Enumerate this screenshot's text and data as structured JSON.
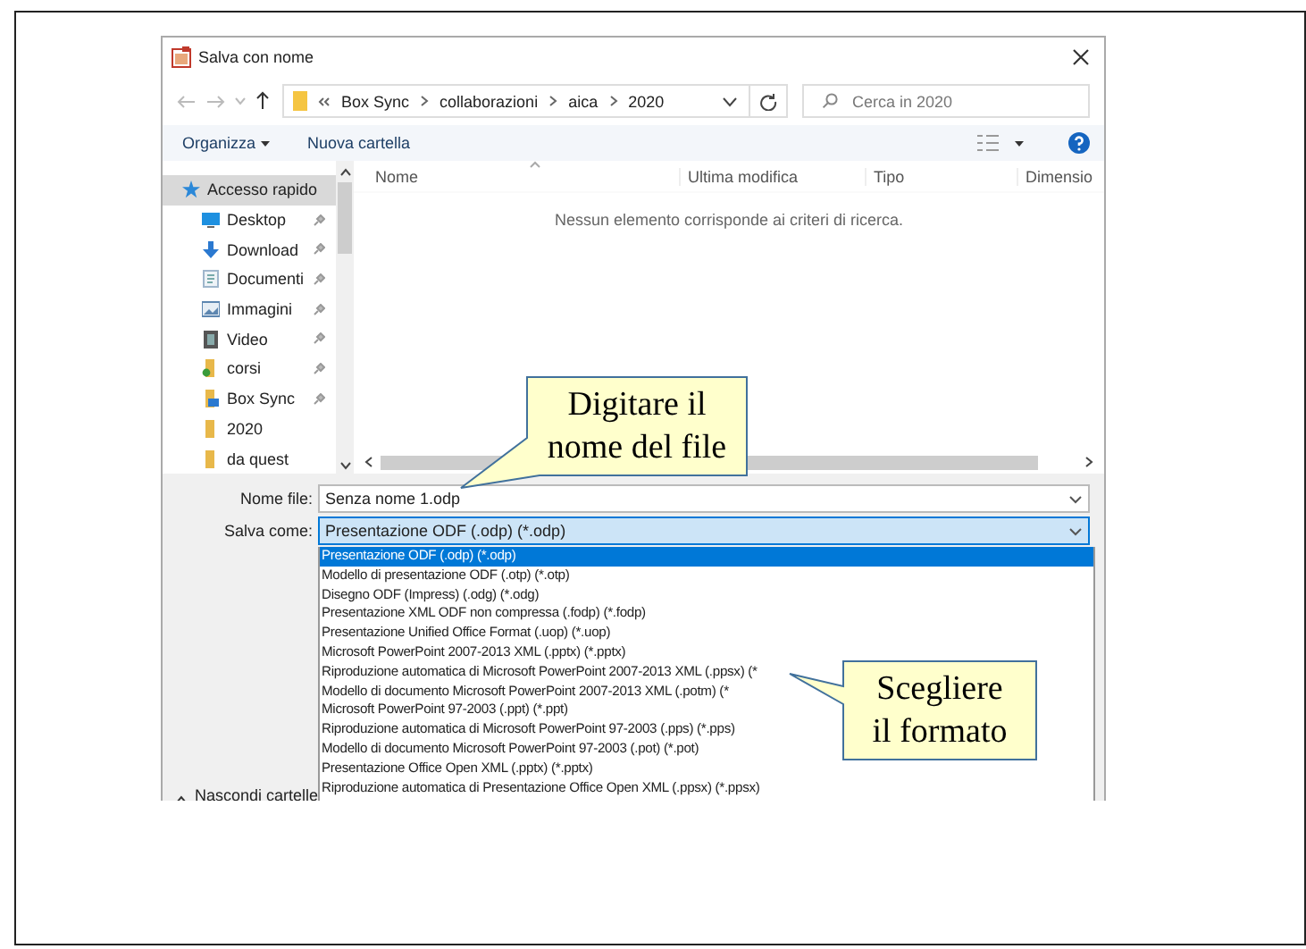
{
  "window": {
    "title": "Salva con nome"
  },
  "address": {
    "path": [
      "Box Sync",
      "collaborazioni",
      "aica",
      "2020"
    ]
  },
  "search": {
    "placeholder": "Cerca in 2020"
  },
  "toolbar": {
    "organize": "Organizza",
    "new_folder": "Nuova cartella"
  },
  "sidebar": {
    "items": [
      {
        "label": "Accesso rapido",
        "kind": "star",
        "pinned": false,
        "selected": true
      },
      {
        "label": "Desktop",
        "kind": "desktop",
        "pinned": true,
        "selected": false
      },
      {
        "label": "Download",
        "kind": "download",
        "pinned": true,
        "selected": false
      },
      {
        "label": "Documenti",
        "kind": "document",
        "pinned": true,
        "selected": false
      },
      {
        "label": "Immagini",
        "kind": "image",
        "pinned": true,
        "selected": false
      },
      {
        "label": "Video",
        "kind": "video",
        "pinned": true,
        "selected": false
      },
      {
        "label": "corsi",
        "kind": "folder-check",
        "pinned": true,
        "selected": false
      },
      {
        "label": "Box Sync",
        "kind": "folder-box",
        "pinned": true,
        "selected": false
      },
      {
        "label": "2020",
        "kind": "folder",
        "pinned": false,
        "selected": false
      },
      {
        "label": "da quest",
        "kind": "folder",
        "pinned": false,
        "selected": false
      }
    ]
  },
  "table": {
    "columns": [
      "Nome",
      "Ultima modifica",
      "Tipo",
      "Dimensio"
    ],
    "empty_message": "Nessun elemento corrisponde ai criteri di ricerca."
  },
  "file_name": {
    "label": "Nome file:",
    "value": "Senza nome 1.odp"
  },
  "save_as": {
    "label": "Salva come:",
    "value": "Presentazione ODF (.odp) (*.odp)",
    "options": [
      {
        "label": "Presentazione ODF (.odp) (*.odp)",
        "selected": true
      },
      {
        "label": "Modello di presentazione ODF (.otp) (*.otp)",
        "selected": false
      },
      {
        "label": "Disegno ODF (Impress) (.odg) (*.odg)",
        "selected": false
      },
      {
        "label": "Presentazione XML ODF non compressa (.fodp) (*.fodp)",
        "selected": false
      },
      {
        "label": "Presentazione Unified Office Format (.uop) (*.uop)",
        "selected": false
      },
      {
        "label": "Microsoft PowerPoint 2007-2013 XML (.pptx) (*.pptx)",
        "selected": false
      },
      {
        "label": "Riproduzione automatica di Microsoft PowerPoint 2007-2013 XML (.ppsx) (*",
        "selected": false
      },
      {
        "label": "Modello di documento Microsoft PowerPoint 2007-2013 XML (.potm) (*",
        "selected": false
      },
      {
        "label": "Microsoft PowerPoint 97-2003 (.ppt) (*.ppt)",
        "selected": false
      },
      {
        "label": "Riproduzione automatica di Microsoft PowerPoint 97-2003 (.pps) (*.pps)",
        "selected": false
      },
      {
        "label": "Modello di documento Microsoft PowerPoint 97-2003 (.pot) (*.pot)",
        "selected": false
      },
      {
        "label": "Presentazione Office Open XML (.pptx) (*.pptx)",
        "selected": false
      },
      {
        "label": "Riproduzione automatica di Presentazione Office Open XML (.ppsx) (*.ppsx)",
        "selected": false
      }
    ]
  },
  "hide_folders": "Nascondi cartelle",
  "callouts": [
    {
      "lines": [
        "Digitare il",
        "nome del file"
      ]
    },
    {
      "lines": [
        "Scegliere",
        "il formato"
      ]
    }
  ]
}
